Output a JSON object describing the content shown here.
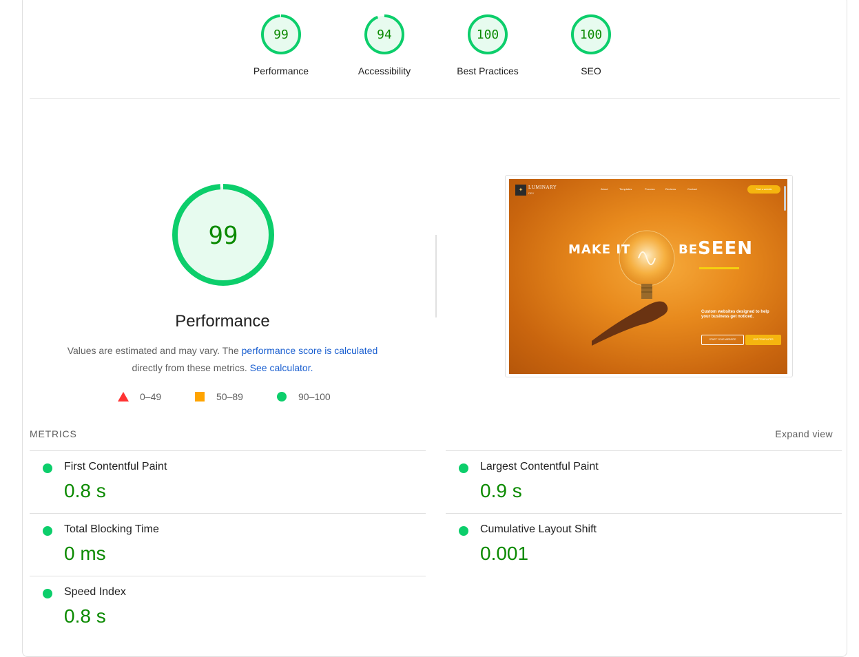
{
  "colors": {
    "pass": "#0cce6b",
    "pass_text": "#0b8a00",
    "average": "#ffa400",
    "fail": "#ff3333",
    "link": "#1a5fd0"
  },
  "gauges": [
    {
      "score": "99",
      "label": "Performance",
      "fraction": 0.99
    },
    {
      "score": "94",
      "label": "Accessibility",
      "fraction": 0.94
    },
    {
      "score": "100",
      "label": "Best Practices",
      "fraction": 1.0
    },
    {
      "score": "100",
      "label": "SEO",
      "fraction": 1.0
    }
  ],
  "performance": {
    "score": "99",
    "fraction": 0.99,
    "title": "Performance",
    "desc_prefix": "Values are estimated and may vary. The ",
    "desc_link1": "performance score is calculated",
    "desc_middle": " directly from these metrics.",
    "desc_link2": "See calculator.",
    "legend": [
      {
        "icon": "triangle-fail-icon",
        "label": "0–49"
      },
      {
        "icon": "square-average-icon",
        "label": "50–89"
      },
      {
        "icon": "circle-pass-icon",
        "label": "90–100"
      }
    ]
  },
  "screenshot": {
    "brand": "LUMINARY",
    "brand_sub": "DEV",
    "nav": [
      "About",
      "Templates",
      "Process",
      "Reviews",
      "Contact"
    ],
    "cta": "Start a website",
    "hero_left": "MAKE IT",
    "hero_mid": "BE",
    "hero_right": "SEEN",
    "subtitle": "Custom websites designed to help your business get noticed.",
    "btn_primary": "START YOUR WEBSITE",
    "btn_secondary": "OUR TEMPLATES"
  },
  "metrics": {
    "heading": "METRICS",
    "expand_label": "Expand view",
    "items": [
      {
        "name": "First Contentful Paint",
        "value": "0.8 s"
      },
      {
        "name": "Largest Contentful Paint",
        "value": "0.9 s"
      },
      {
        "name": "Total Blocking Time",
        "value": "0 ms"
      },
      {
        "name": "Cumulative Layout Shift",
        "value": "0.001"
      },
      {
        "name": "Speed Index",
        "value": "0.8 s"
      }
    ]
  }
}
